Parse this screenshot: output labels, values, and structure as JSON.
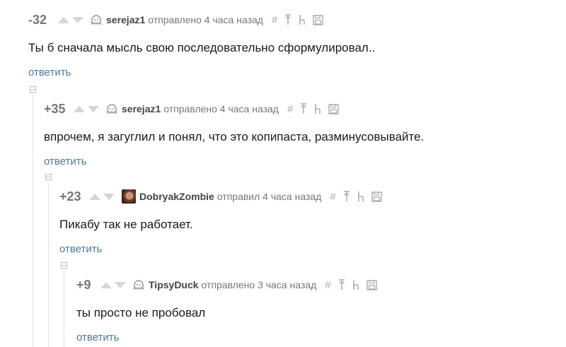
{
  "comments": [
    {
      "rating": "-32",
      "author": "serejaz1",
      "meta": "отправлено 4 часа назад",
      "text": "Ты б сначала мысль свою последовательно сформулировал..",
      "reply": "ответить",
      "avatar": "ghost-icon"
    },
    {
      "rating": "+35",
      "author": "serejaz1",
      "meta": "отправлено 4 часа назад",
      "text": "впрочем, я загуглил и понял, что это копипаста, разминусовывайте.",
      "reply": "ответить",
      "avatar": "ghost-icon"
    },
    {
      "rating": "+23",
      "author": "DobryakZombie",
      "meta": "отправил 4 часа назад",
      "text": "Пикабу так не работает.",
      "reply": "ответить",
      "avatar": "user-photo"
    },
    {
      "rating": "+9",
      "author": "TipsyDuck",
      "meta": "отправлено 3 часа назад",
      "text": "ты просто не пробовал",
      "reply": "ответить",
      "avatar": "ghost-icon"
    }
  ],
  "tool_icons": [
    "hash-icon",
    "arrow-up-icon",
    "parent-icon",
    "save-icon"
  ],
  "colors": {
    "link": "#4a78a6",
    "muted": "#777777",
    "vote_arrow": "#d6d6d6"
  }
}
